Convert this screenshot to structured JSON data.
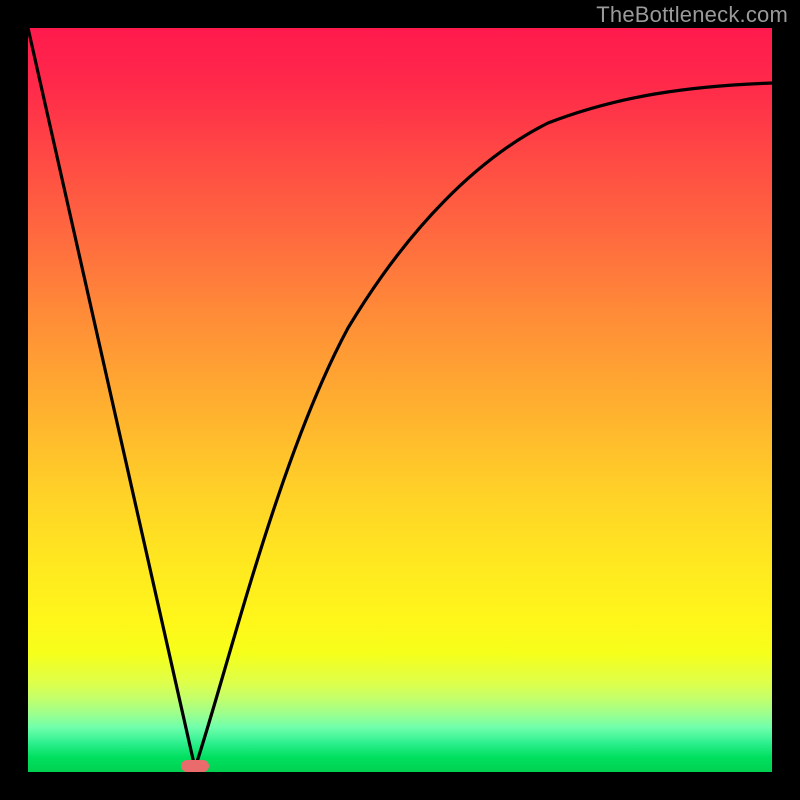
{
  "watermark": "TheBottleneck.com",
  "chart_data": {
    "type": "line",
    "title": "",
    "xlabel": "",
    "ylabel": "",
    "xlim": [
      0,
      1
    ],
    "ylim": [
      0,
      1
    ],
    "series": [
      {
        "name": "bottleneck-curve",
        "x": [
          0.0,
          0.05,
          0.1,
          0.15,
          0.2,
          0.225,
          0.25,
          0.3,
          0.35,
          0.4,
          0.45,
          0.5,
          0.55,
          0.6,
          0.65,
          0.7,
          0.75,
          0.8,
          0.85,
          0.9,
          0.95,
          1.0
        ],
        "y": [
          1.0,
          0.78,
          0.56,
          0.33,
          0.11,
          0.0,
          0.1,
          0.34,
          0.5,
          0.62,
          0.7,
          0.76,
          0.81,
          0.84,
          0.86,
          0.88,
          0.89,
          0.9,
          0.905,
          0.91,
          0.915,
          0.92
        ]
      }
    ],
    "marker": {
      "x": 0.225,
      "y": 0.008
    },
    "gradient_stops": [
      {
        "pos": 0.0,
        "color": "#ff1a4d"
      },
      {
        "pos": 0.5,
        "color": "#ffad30"
      },
      {
        "pos": 0.8,
        "color": "#fff71a"
      },
      {
        "pos": 1.0,
        "color": "#00d050"
      }
    ]
  }
}
